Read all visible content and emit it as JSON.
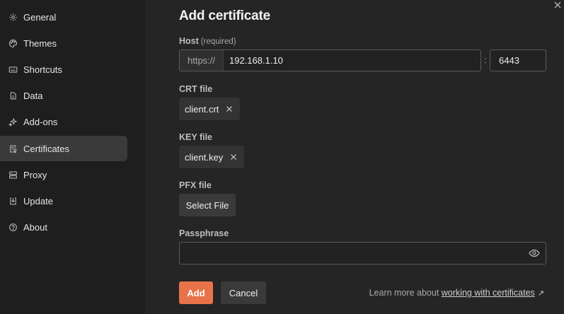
{
  "sidebar": {
    "items": [
      {
        "label": "General",
        "icon": "gear-icon"
      },
      {
        "label": "Themes",
        "icon": "palette-icon"
      },
      {
        "label": "Shortcuts",
        "icon": "keyboard-icon"
      },
      {
        "label": "Data",
        "icon": "database-icon"
      },
      {
        "label": "Add-ons",
        "icon": "sparkle-icon"
      },
      {
        "label": "Certificates",
        "icon": "certificate-icon",
        "active": true
      },
      {
        "label": "Proxy",
        "icon": "proxy-icon"
      },
      {
        "label": "Update",
        "icon": "download-icon"
      },
      {
        "label": "About",
        "icon": "info-icon"
      }
    ]
  },
  "form": {
    "title": "Add certificate",
    "host_label": "Host",
    "host_required": "(required)",
    "host_prefix": "https://",
    "host_value": "192.168.1.10",
    "port_separator": ":",
    "port_value": "6443",
    "crt_label": "CRT file",
    "crt_file": "client.crt",
    "key_label": "KEY file",
    "key_file": "client.key",
    "pfx_label": "PFX file",
    "pfx_button": "Select File",
    "passphrase_label": "Passphrase",
    "passphrase_value": "",
    "add_button": "Add",
    "cancel_button": "Cancel",
    "learn_prefix": "Learn more about",
    "learn_link": "working with certificates",
    "learn_arrow": "↗"
  },
  "colors": {
    "accent": "#e8734a",
    "background": "#252525",
    "sidebar": "#1e1e1e"
  }
}
